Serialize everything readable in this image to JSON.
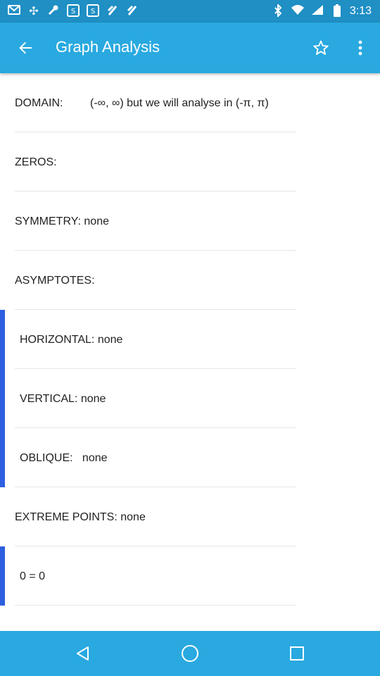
{
  "status_bar": {
    "time": "3:13",
    "left_icons": [
      "mail-icon",
      "pinwheel-icon",
      "wrench-icon",
      "sfr-icon",
      "sfr-icon",
      "sfr-icon",
      "sfr-icon"
    ],
    "right_icons": [
      "bluetooth-icon",
      "wifi-icon",
      "signal-icon",
      "battery-icon"
    ]
  },
  "app_bar": {
    "title": "Graph Analysis"
  },
  "rows": [
    {
      "label": "DOMAIN:",
      "value": "(-∞, ∞) but we will analyse in (-π, π)"
    },
    {
      "label": "ZEROS:",
      "value": ""
    },
    {
      "label": "SYMMETRY: none",
      "value": ""
    },
    {
      "label": "ASYMPTOTES:",
      "value": ""
    },
    {
      "label": "HORIZONTAL: none",
      "value": ""
    },
    {
      "label": "VERTICAL: none",
      "value": ""
    },
    {
      "label": "OBLIQUE:   none",
      "value": ""
    },
    {
      "label": "EXTREME POINTS: none",
      "value": ""
    },
    {
      "label": "0 = 0",
      "value": ""
    }
  ],
  "colors": {
    "status_bar": "#1f8fc4",
    "app_bar": "#29a9e0",
    "accent": "#2d5fe0",
    "nav_bar": "#29a9e0"
  }
}
